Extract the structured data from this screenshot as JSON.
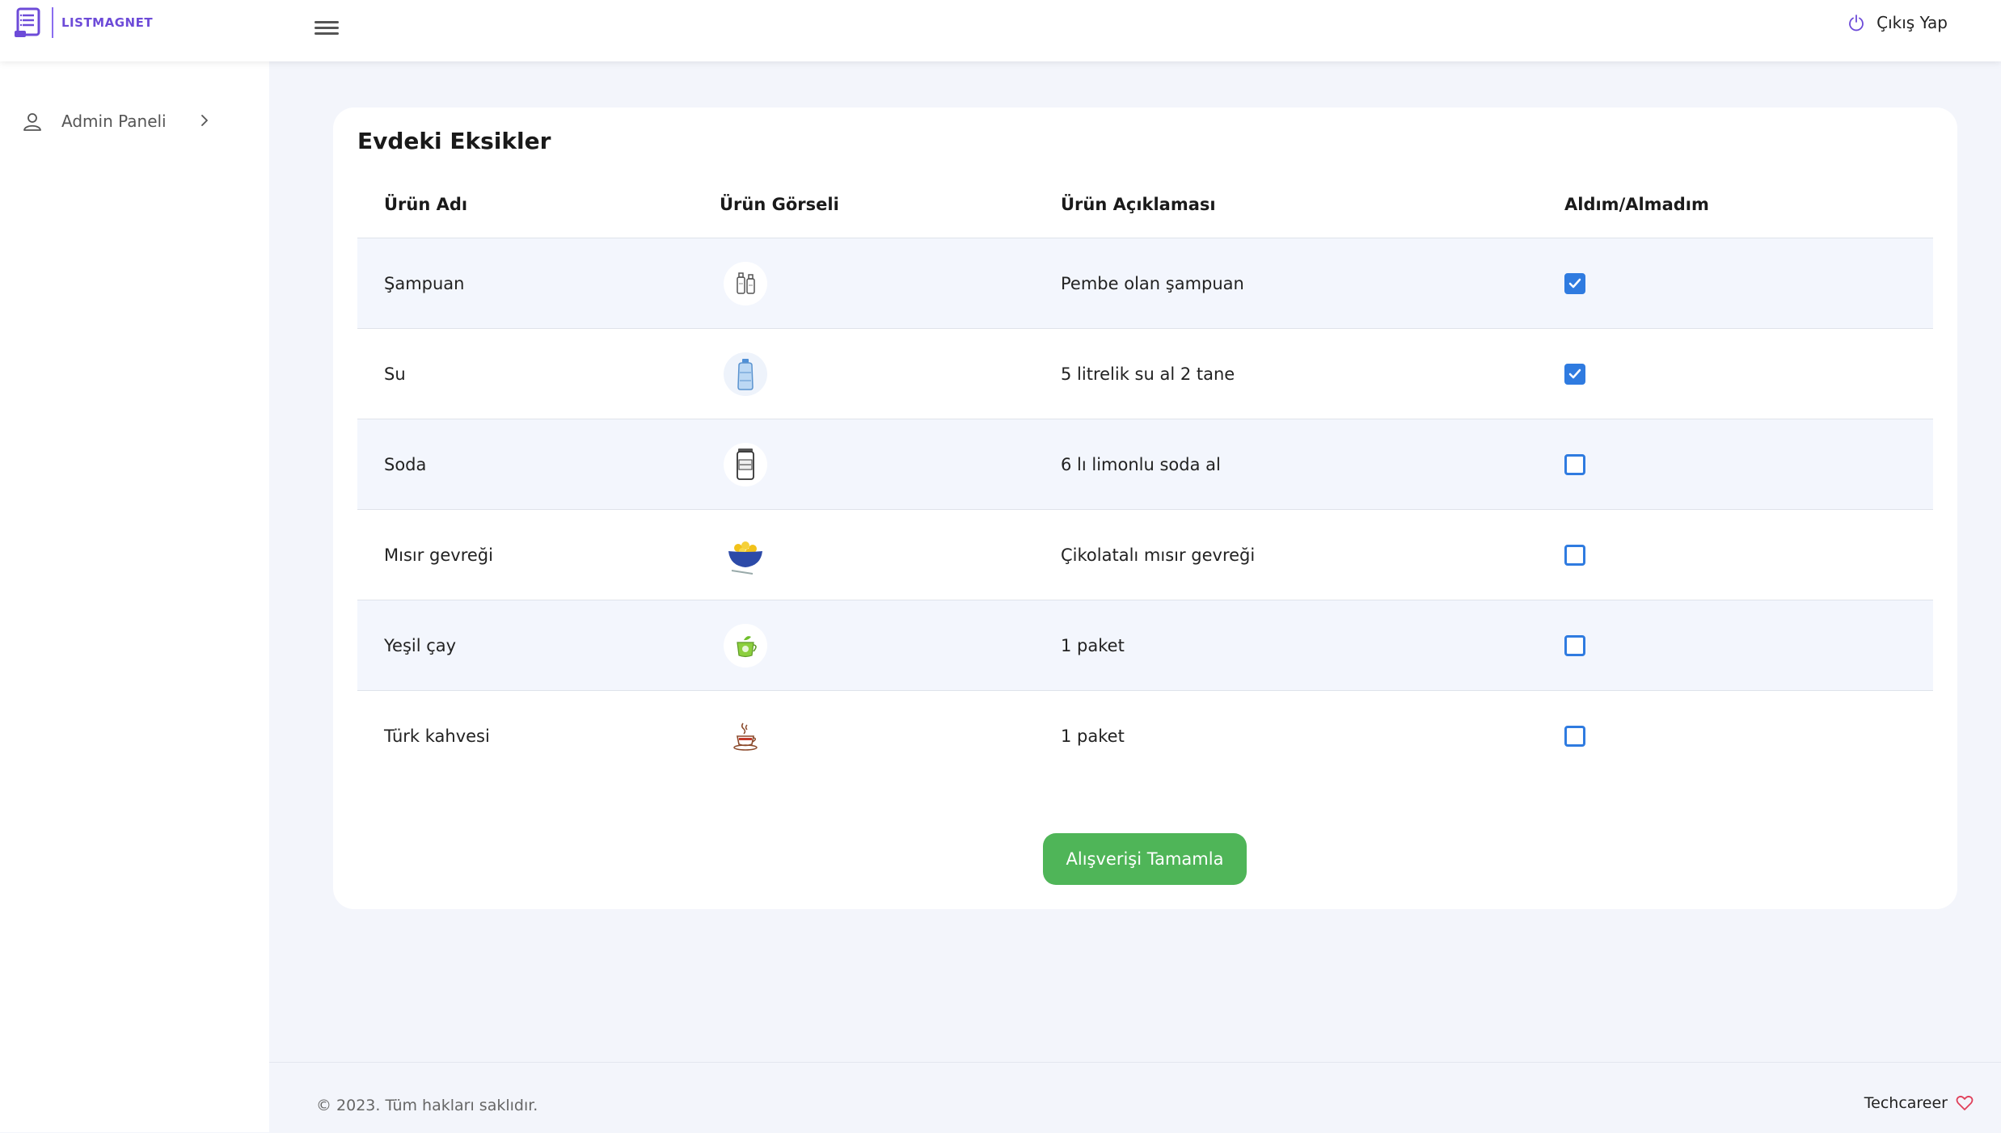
{
  "app": {
    "logo_text": "LISTMAGNET"
  },
  "header": {
    "logout_label": "Çıkış Yap"
  },
  "sidebar": {
    "items": [
      {
        "label": "Admin Paneli"
      }
    ]
  },
  "main": {
    "title": "Evdeki Eksikler",
    "columns": [
      "Ürün Adı",
      "Ürün Görseli",
      "Ürün Açıklaması",
      "Aldım/Almadım"
    ],
    "rows": [
      {
        "name": "Şampuan",
        "icon": "shampoo-icon",
        "description": "Pembe olan şampuan",
        "checked": true
      },
      {
        "name": "Su",
        "icon": "water-bottle-icon",
        "description": "5 litrelik su al 2 tane",
        "checked": true
      },
      {
        "name": "Soda",
        "icon": "soda-can-icon",
        "description": "6 lı limonlu soda al",
        "checked": false
      },
      {
        "name": "Mısır gevreği",
        "icon": "cereal-bowl-icon",
        "description": "Çikolatalı mısır gevreği",
        "checked": false
      },
      {
        "name": "Yeşil çay",
        "icon": "green-tea-icon",
        "description": "1 paket",
        "checked": false
      },
      {
        "name": "Türk kahvesi",
        "icon": "turkish-coffee-icon",
        "description": "1 paket",
        "checked": false
      }
    ],
    "complete_button": "Alışverişi Tamamla"
  },
  "footer": {
    "copyright": "© 2023. Tüm hakları saklıdır.",
    "brand": "Techcareer"
  },
  "colors": {
    "accent": "#6d4bd8",
    "checkbox": "#2f7be0",
    "button_green": "#4fb558",
    "heart": "#e0405a"
  }
}
